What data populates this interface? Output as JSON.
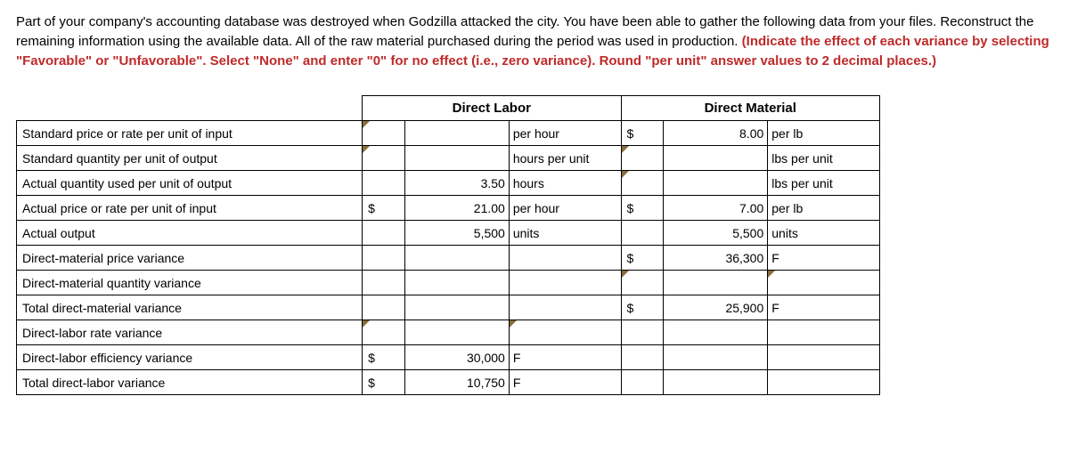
{
  "intro": {
    "text_black": "Part of your company's accounting database was destroyed when Godzilla attacked the city. You have been able to gather the following data from your files. Reconstruct the remaining information using the available data. All of the raw material purchased during the period was used in production. ",
    "text_red": "(Indicate the effect of each variance by selecting \"Favorable\" or \"Unfavorable\". Select \"None\" and enter \"0\" for no effect (i.e., zero variance). Round \"per unit\" answer values to 2 decimal places.)"
  },
  "headers": {
    "dl": "Direct Labor",
    "dm": "Direct Material"
  },
  "rows": {
    "r1": {
      "label": "Standard price or rate per unit of input",
      "dl_unit": "per hour",
      "dm_sym": "$",
      "dm_num": "8.00",
      "dm_unit": "per lb"
    },
    "r2": {
      "label": "Standard quantity per unit of output",
      "dl_unit": "hours per unit",
      "dm_unit": "lbs per unit"
    },
    "r3": {
      "label": "Actual quantity used per unit of output",
      "dl_num": "3.50",
      "dl_unit": "hours",
      "dm_unit": "lbs per unit"
    },
    "r4": {
      "label": "Actual price or rate per unit of input",
      "dl_sym": "$",
      "dl_num": "21.00",
      "dl_unit": "per hour",
      "dm_sym": "$",
      "dm_num": "7.00",
      "dm_unit": "per lb"
    },
    "r5": {
      "label": "Actual output",
      "dl_num": "5,500",
      "dl_unit": "units",
      "dm_num": "5,500",
      "dm_unit": "units"
    },
    "r6": {
      "label": "Direct-material price variance",
      "dm_sym": "$",
      "dm_num": "36,300",
      "dm_unit": "F"
    },
    "r7": {
      "label": "Direct-material quantity variance"
    },
    "r8": {
      "label": "Total direct-material variance",
      "dm_sym": "$",
      "dm_num": "25,900",
      "dm_unit": "F"
    },
    "r9": {
      "label": "Direct-labor rate variance"
    },
    "r10": {
      "label": "Direct-labor efficiency variance",
      "dl_sym": "$",
      "dl_num": "30,000",
      "dl_unit": "F"
    },
    "r11": {
      "label": "Total direct-labor variance",
      "dl_sym": "$",
      "dl_num": "10,750",
      "dl_unit": "F"
    }
  }
}
